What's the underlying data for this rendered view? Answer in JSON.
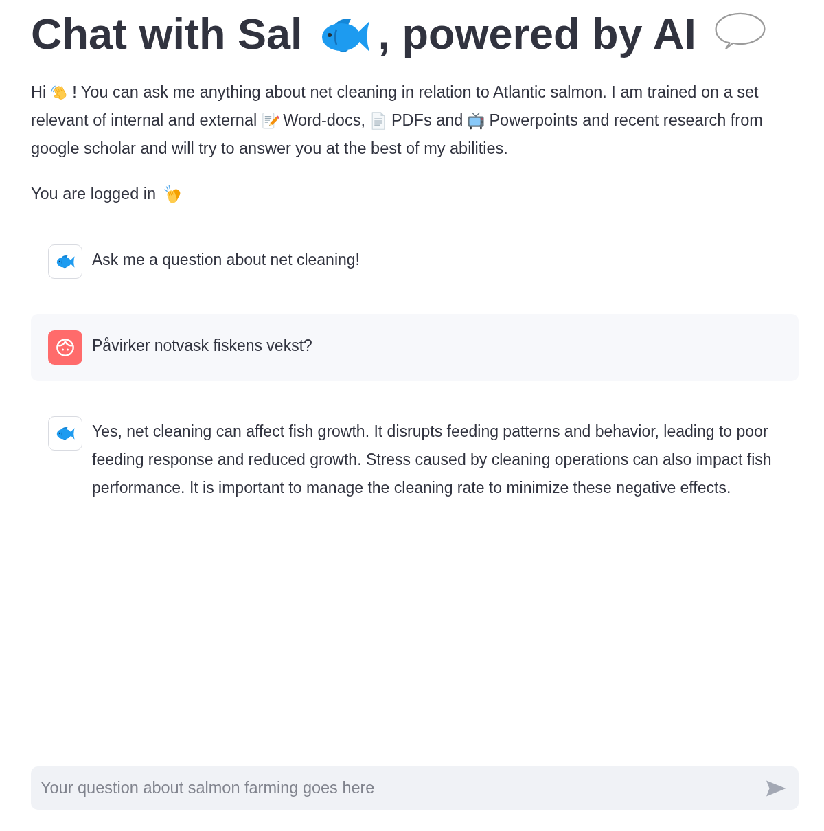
{
  "title": {
    "segments": [
      {
        "kind": "text",
        "text": "Chat with Sal"
      },
      {
        "kind": "emoji"
      },
      {
        "kind": "text",
        "text": ", powered by AI"
      },
      {
        "kind": "emoji"
      }
    ]
  },
  "intro": {
    "lines": [
      [
        {
          "kind": "text",
          "text": "Hi"
        },
        {
          "kind": "emoji"
        },
        {
          "kind": "text",
          "text": "! You can ask me anything about net cleaning in relation to Atlantic salmon. I am trained on a set"
        }
      ],
      [
        {
          "kind": "text",
          "text": "relevant of internal and external"
        },
        {
          "kind": "emoji"
        },
        {
          "kind": "text",
          "text": "Word-docs,"
        },
        {
          "kind": "emoji"
        },
        {
          "kind": "text",
          "text": "PDFs and"
        },
        {
          "kind": "emoji"
        },
        {
          "kind": "text",
          "text": "Powerpoints and recent research from"
        }
      ],
      [
        {
          "kind": "text",
          "text": "google scholar and will try to answer you at the best of my abilities."
        }
      ]
    ]
  },
  "status": {
    "segments": [
      {
        "kind": "text",
        "text": "You are logged in"
      },
      {
        "kind": "emoji"
      }
    ]
  },
  "messages": [
    {
      "kind": "assistant",
      "text": "Ask me a question about net cleaning!"
    },
    {
      "kind": "user",
      "text": "Påvirker notvask fiskens vekst?"
    },
    {
      "kind": "assistant",
      "text": "Yes, net cleaning can affect fish growth. It disrupts feeding patterns and behavior, leading to poor feeding response and reduced growth. Stress caused by cleaning operations can also impact fish performance. It is important to manage the cleaning rate to minimize these negative effects."
    }
  ],
  "chat_input": {
    "placeholder": "Your question about salmon farming goes here"
  }
}
